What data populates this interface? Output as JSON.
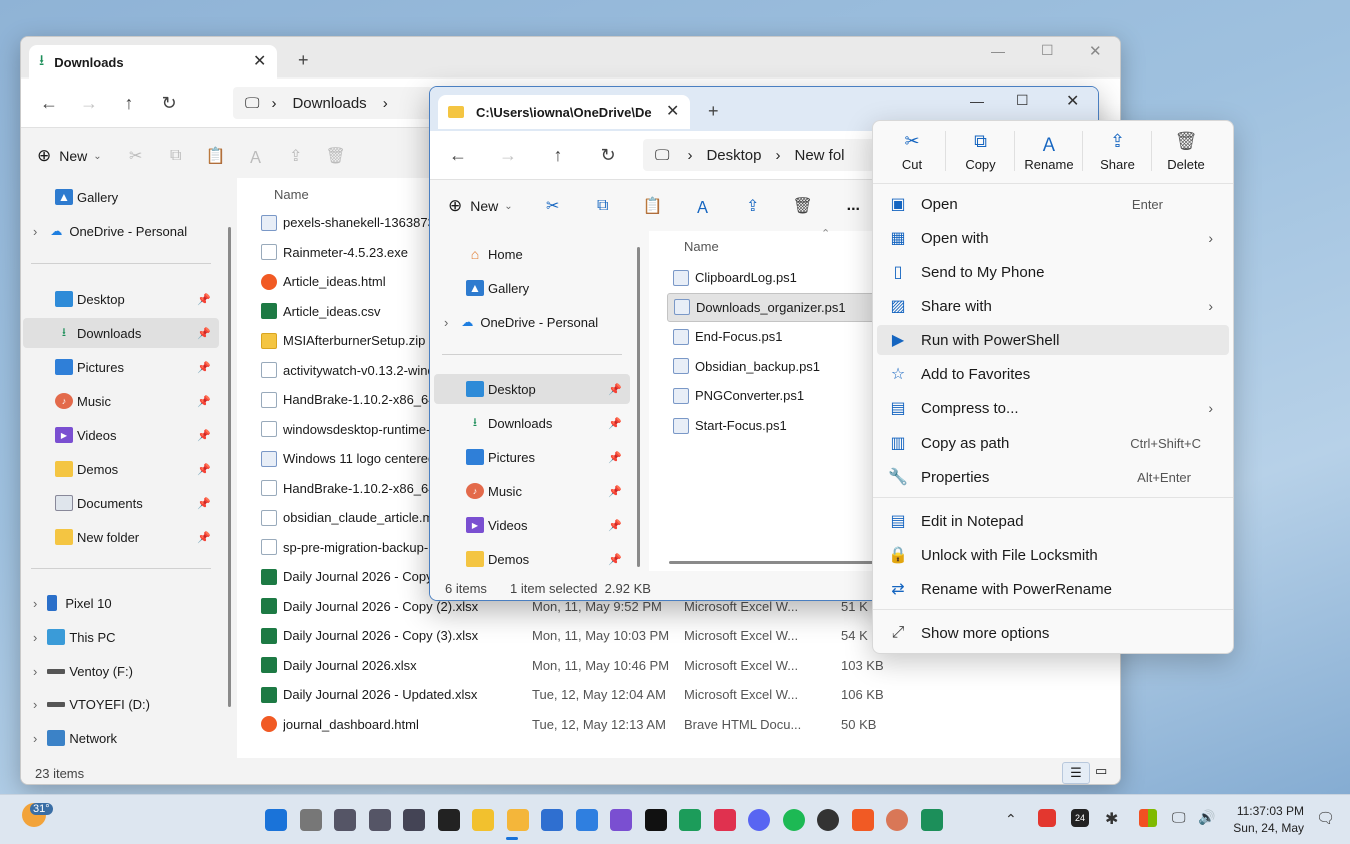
{
  "back_window": {
    "tab_title": "Downloads",
    "new_tab": "+",
    "address": [
      "Downloads"
    ],
    "new_label": "New",
    "sidebar": {
      "top": [
        {
          "label": "Gallery"
        },
        {
          "label": "OneDrive - Personal"
        }
      ],
      "pinned": [
        {
          "label": "Desktop"
        },
        {
          "label": "Downloads"
        },
        {
          "label": "Pictures"
        },
        {
          "label": "Music"
        },
        {
          "label": "Videos"
        },
        {
          "label": "Demos"
        },
        {
          "label": "Documents"
        },
        {
          "label": "New folder"
        }
      ],
      "drives": [
        {
          "label": "Pixel 10"
        },
        {
          "label": "This PC"
        },
        {
          "label": "Ventoy (F:)"
        },
        {
          "label": "VTOYEFI (D:)"
        },
        {
          "label": "Network"
        }
      ]
    },
    "name_header": "Name",
    "files": [
      {
        "name": "pexels-shanekell-1363873",
        "type": "img",
        "date": "",
        "kind": "",
        "size": ""
      },
      {
        "name": "Rainmeter-4.5.23.exe",
        "type": "exe",
        "date": "",
        "kind": "",
        "size": ""
      },
      {
        "name": "Article_ideas.html",
        "type": "html",
        "date": "",
        "kind": "",
        "size": ""
      },
      {
        "name": "Article_ideas.csv",
        "type": "xl",
        "date": "",
        "kind": "",
        "size": ""
      },
      {
        "name": "MSIAfterburnerSetup.zip",
        "type": "zip",
        "date": "",
        "kind": "",
        "size": ""
      },
      {
        "name": "activitywatch-v0.13.2-wind",
        "type": "exe",
        "date": "",
        "kind": "",
        "size": ""
      },
      {
        "name": "HandBrake-1.10.2-x86_64-",
        "type": "exe",
        "date": "",
        "kind": "",
        "size": ""
      },
      {
        "name": "windowsdesktop-runtime-",
        "type": "exe",
        "date": "",
        "kind": "",
        "size": ""
      },
      {
        "name": "Windows 11 logo centered",
        "type": "img",
        "date": "",
        "kind": "",
        "size": ""
      },
      {
        "name": "HandBrake-1.10.2-x86_64-",
        "type": "exe",
        "date": "",
        "kind": "",
        "size": ""
      },
      {
        "name": "obsidian_claude_article.md",
        "type": "doc",
        "date": "",
        "kind": "",
        "size": ""
      },
      {
        "name": "sp-pre-migration-backup-",
        "type": "doc",
        "date": "",
        "kind": "",
        "size": ""
      },
      {
        "name": "Daily Journal 2026 - Copy.",
        "type": "xl",
        "date": "",
        "kind": "",
        "size": ""
      },
      {
        "name": "Daily Journal 2026 - Copy (2).xlsx",
        "type": "xl",
        "date": "Mon, 11, May 9:52 PM",
        "kind": "Microsoft Excel W...",
        "size": "51 K"
      },
      {
        "name": "Daily Journal 2026 - Copy (3).xlsx",
        "type": "xl",
        "date": "Mon, 11, May 10:03 PM",
        "kind": "Microsoft Excel W...",
        "size": "54 K"
      },
      {
        "name": "Daily Journal 2026.xlsx",
        "type": "xl",
        "date": "Mon, 11, May 10:46 PM",
        "kind": "Microsoft Excel W...",
        "size": "103 KB"
      },
      {
        "name": "Daily Journal 2026 - Updated.xlsx",
        "type": "xl",
        "date": "Tue, 12, May 12:04 AM",
        "kind": "Microsoft Excel W...",
        "size": "106 KB"
      },
      {
        "name": "journal_dashboard.html",
        "type": "html",
        "date": "Tue, 12, May 12:13 AM",
        "kind": "Brave HTML Docu...",
        "size": "50 KB"
      }
    ],
    "status": "23 items"
  },
  "front_window": {
    "tab_title": "C:\\Users\\iowna\\OneDrive\\De",
    "new_tab": "+",
    "address": [
      "Desktop",
      "New fol"
    ],
    "new_label": "New",
    "more": "...",
    "sidebar": {
      "top": [
        {
          "label": "Home"
        },
        {
          "label": "Gallery"
        },
        {
          "label": "OneDrive - Personal"
        }
      ],
      "pinned": [
        {
          "label": "Desktop"
        },
        {
          "label": "Downloads"
        },
        {
          "label": "Pictures"
        },
        {
          "label": "Music"
        },
        {
          "label": "Videos"
        },
        {
          "label": "Demos"
        }
      ]
    },
    "name_header": "Name",
    "files": [
      {
        "name": "ClipboardLog.ps1"
      },
      {
        "name": "Downloads_organizer.ps1"
      },
      {
        "name": "End-Focus.ps1"
      },
      {
        "name": "Obsidian_backup.ps1"
      },
      {
        "name": "PNGConverter.ps1"
      },
      {
        "name": "Start-Focus.ps1"
      }
    ],
    "status_count": "6 items",
    "status_selected": "1 item selected  2.92 KB"
  },
  "context_menu": {
    "top_actions": [
      {
        "label": "Cut",
        "icon": "scissors-icon"
      },
      {
        "label": "Copy",
        "icon": "copy-icon"
      },
      {
        "label": "Rename",
        "icon": "rename-icon"
      },
      {
        "label": "Share",
        "icon": "share-icon"
      },
      {
        "label": "Delete",
        "icon": "trash-icon"
      }
    ],
    "items": [
      {
        "label": "Open",
        "shortcut": "Enter",
        "arrow": false
      },
      {
        "label": "Open with",
        "shortcut": "",
        "arrow": true
      },
      {
        "label": "Send to My Phone",
        "shortcut": "",
        "arrow": false
      },
      {
        "label": "Share with",
        "shortcut": "",
        "arrow": true
      },
      {
        "label": "Run with PowerShell",
        "shortcut": "",
        "arrow": false
      },
      {
        "label": "Add to Favorites",
        "shortcut": "",
        "arrow": false
      },
      {
        "label": "Compress to...",
        "shortcut": "",
        "arrow": true
      },
      {
        "label": "Copy as path",
        "shortcut": "Ctrl+Shift+C",
        "arrow": false
      },
      {
        "label": "Properties",
        "shortcut": "Alt+Enter",
        "arrow": false
      },
      {
        "label": "Edit in Notepad",
        "shortcut": "",
        "arrow": false
      },
      {
        "label": "Unlock with File Locksmith",
        "shortcut": "",
        "arrow": false
      },
      {
        "label": "Rename with PowerRename",
        "shortcut": "",
        "arrow": false
      },
      {
        "label": "Show more options",
        "shortcut": "",
        "arrow": false
      }
    ]
  },
  "taskbar": {
    "weather": "31°",
    "time": "11:37:03 PM",
    "date": "Sun, 24, May"
  }
}
